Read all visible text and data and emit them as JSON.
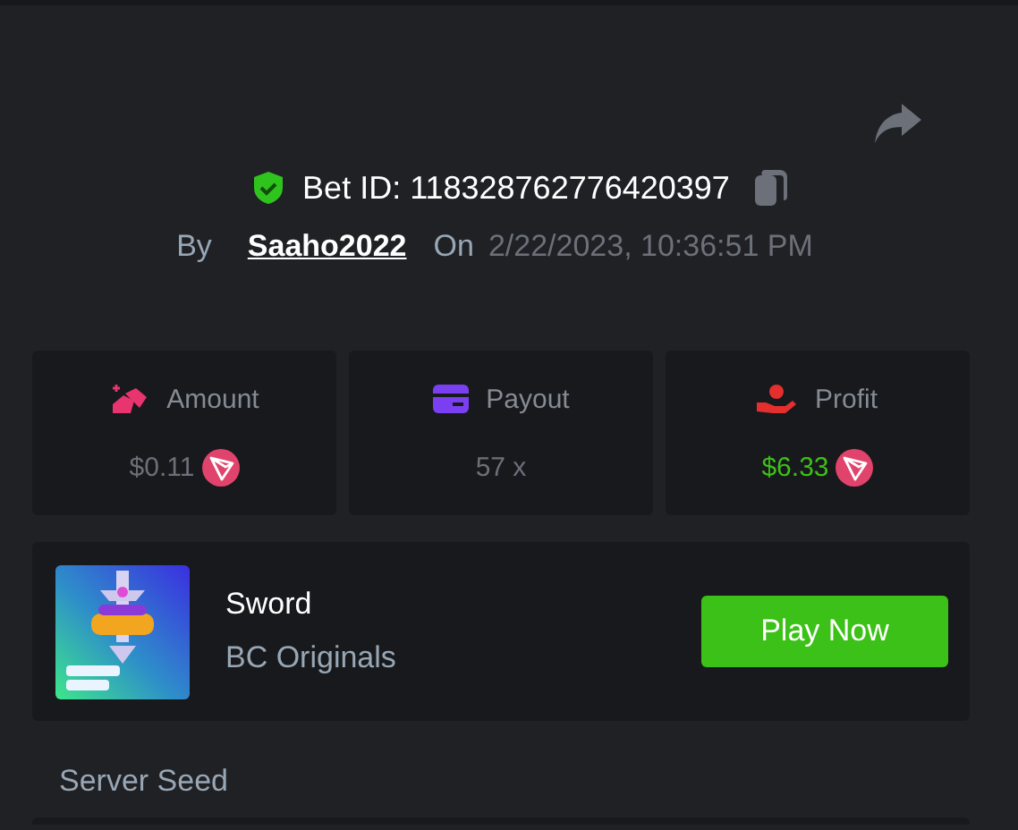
{
  "bet": {
    "verified": true,
    "label": "Bet ID:",
    "id": "118328762776420397",
    "by_label": "By",
    "user": "Saaho2022",
    "on_label": "On",
    "date": "2/22/2023, 10:36:51 PM"
  },
  "stats": [
    {
      "kind": "amount",
      "label": "Amount",
      "value": "$0.11",
      "coin": true,
      "positive": false
    },
    {
      "kind": "payout",
      "label": "Payout",
      "value": "57 x",
      "coin": false,
      "positive": false
    },
    {
      "kind": "profit",
      "label": "Profit",
      "value": "$6.33",
      "coin": true,
      "positive": true
    }
  ],
  "game": {
    "name": "Sword",
    "provider": "BC Originals",
    "button": "Play Now"
  },
  "server_seed": {
    "label": "Server Seed"
  }
}
